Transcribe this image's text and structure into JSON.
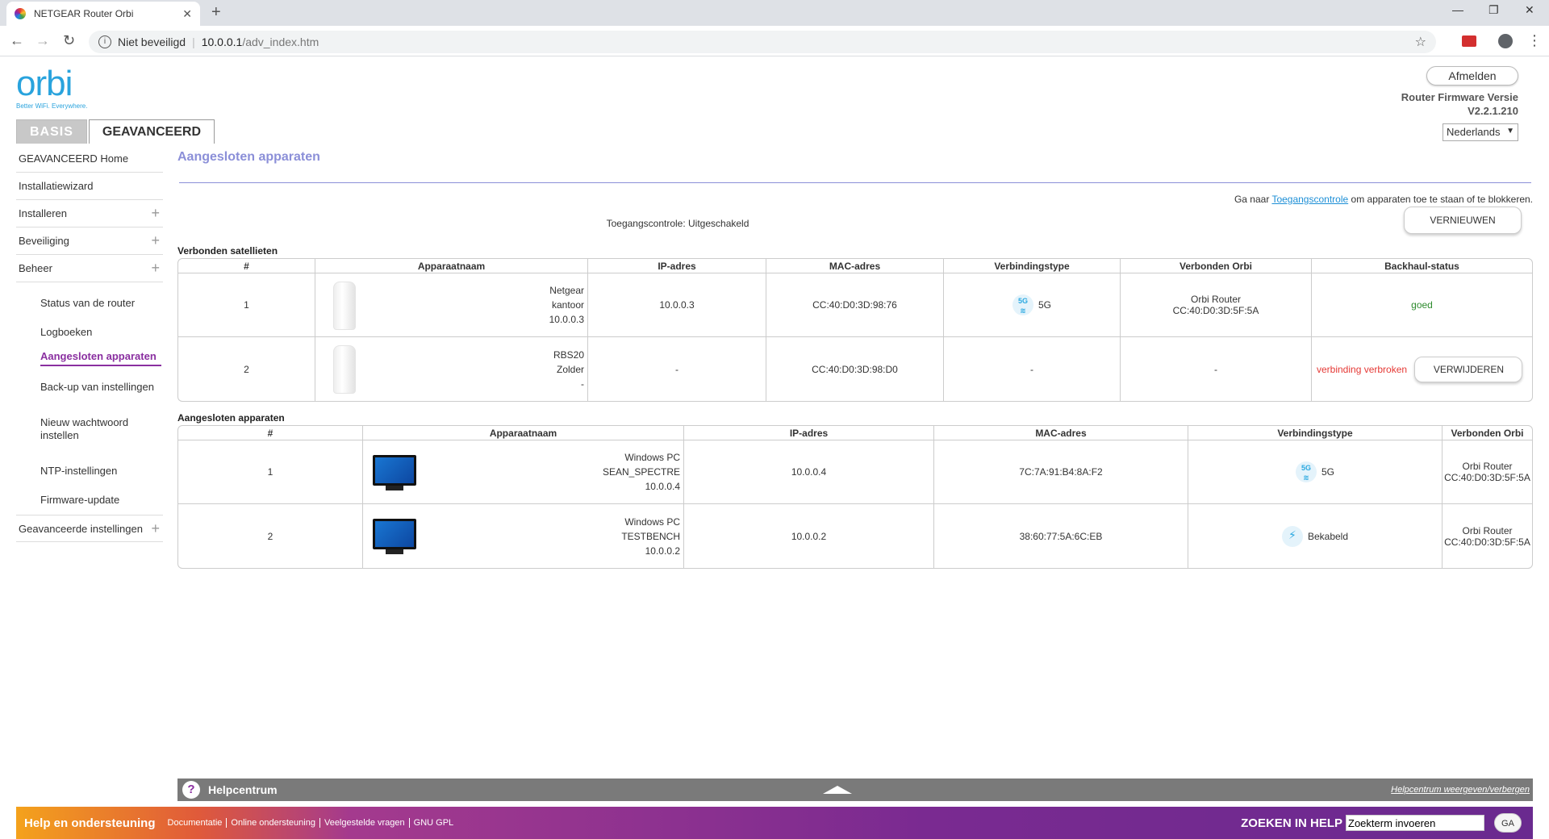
{
  "browser": {
    "tab_title": "NETGEAR Router Orbi",
    "security": "Niet beveiligd",
    "url_host": "10.0.0.1",
    "url_path": "/adv_index.htm"
  },
  "header": {
    "logo": "orbi",
    "logo_tag": "Better WiFi. Everywhere.",
    "tab_basic": "BASIS",
    "tab_advanced": "GEAVANCEERD",
    "logout": "Afmelden",
    "fw_label": "Router Firmware Versie",
    "fw_version": "V2.2.1.210",
    "language": "Nederlands"
  },
  "sidebar": {
    "items": [
      {
        "label": "GEAVANCEERD Home",
        "plus": ""
      },
      {
        "label": "Installatiewizard",
        "plus": ""
      },
      {
        "label": "Installeren",
        "plus": "+"
      },
      {
        "label": "Beveiliging",
        "plus": "+"
      },
      {
        "label": "Beheer",
        "plus": "+"
      }
    ],
    "sub": [
      "Status van de router",
      "Logboeken",
      "Aangesloten apparaten",
      "Back-up van instellingen",
      "Nieuw wachtwoord instellen",
      "NTP-instellingen",
      "Firmware-update"
    ],
    "advanced_settings": "Geavanceerde instellingen"
  },
  "content": {
    "title": "Aangesloten apparaten",
    "goto_pre": "Ga naar",
    "goto_link": "Toegangscontrole",
    "goto_post": "om apparaten toe te staan of te blokkeren.",
    "access_status": "Toegangscontrole: Uitgeschakeld",
    "refresh": "VERNIEUWEN",
    "sat_section": "Verbonden satellieten",
    "sat_headers": [
      "#",
      "Apparaatnaam",
      "IP-adres",
      "MAC-adres",
      "Verbindingstype",
      "Verbonden Orbi",
      "Backhaul-status"
    ],
    "satellites": [
      {
        "num": "1",
        "name1": "Netgear",
        "name2": "kantoor",
        "name3": "10.0.0.3",
        "ip": "10.0.0.3",
        "mac": "CC:40:D0:3D:98:76",
        "conn": "5G",
        "orbi1": "Orbi Router",
        "orbi2": "CC:40:D0:3D:5F:5A",
        "status": "goed"
      },
      {
        "num": "2",
        "name1": "RBS20",
        "name2": "Zolder",
        "name3": "-",
        "ip": "-",
        "mac": "CC:40:D0:3D:98:D0",
        "conn": "-",
        "orbi1": "-",
        "orbi2": "",
        "status": "verbinding verbroken",
        "remove": "VERWIJDEREN"
      }
    ],
    "dev_section": "Aangesloten apparaten",
    "dev_headers": [
      "#",
      "Apparaatnaam",
      "IP-adres",
      "MAC-adres",
      "Verbindingstype",
      "Verbonden Orbi"
    ],
    "devices": [
      {
        "num": "1",
        "name1": "Windows PC",
        "name2": "SEAN_SPECTRE",
        "name3": "10.0.0.4",
        "ip": "10.0.0.4",
        "mac": "7C:7A:91:B4:8A:F2",
        "conn": "5G",
        "orbi1": "Orbi Router",
        "orbi2": "CC:40:D0:3D:5F:5A"
      },
      {
        "num": "2",
        "name1": "Windows PC",
        "name2": "TESTBENCH",
        "name3": "10.0.0.2",
        "ip": "10.0.0.2",
        "mac": "38:60:77:5A:6C:EB",
        "conn": "Bekabeld",
        "orbi1": "Orbi Router",
        "orbi2": "CC:40:D0:3D:5F:5A"
      }
    ]
  },
  "help": {
    "center": "Helpcentrum",
    "toggle": "Helpcentrum weergeven/verbergen",
    "support": "Help en ondersteuning",
    "links": [
      "Documentatie",
      "Online ondersteuning",
      "Veelgestelde vragen",
      "GNU GPL"
    ],
    "search_label": "ZOEKEN IN HELP",
    "search_placeholder": "Zoekterm invoeren",
    "go": "GA"
  }
}
